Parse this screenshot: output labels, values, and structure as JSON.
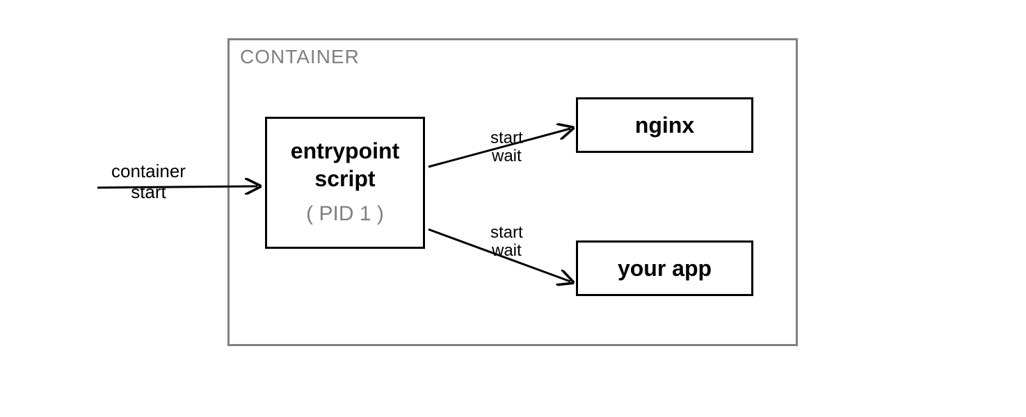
{
  "container_title": "CONTAINER",
  "entrypoint": {
    "line1": "entrypoint",
    "line2": "script",
    "pid": "( PID 1 )"
  },
  "nginx_label": "nginx",
  "app_label": "your app",
  "arrow_container_start": {
    "line1": "container",
    "line2": "start"
  },
  "arrow_start_wait_top": {
    "line1": "start",
    "line2": "wait"
  },
  "arrow_start_wait_bottom": {
    "line1": "start",
    "line2": "wait"
  }
}
